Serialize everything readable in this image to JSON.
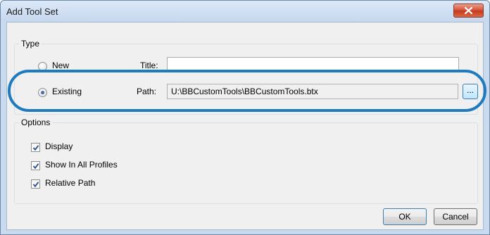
{
  "window": {
    "title": "Add Tool Set"
  },
  "type_group": {
    "legend": "Type",
    "new_label": "New",
    "existing_label": "Existing",
    "title_label": "Title:",
    "title_value": "",
    "path_label": "Path:",
    "path_value": "U:\\BBCustomTools\\BBCustomTools.btx",
    "browse_label": "...",
    "selected": "existing"
  },
  "options_group": {
    "legend": "Options",
    "items": [
      {
        "label": "Display",
        "checked": true
      },
      {
        "label": "Show In All Profiles",
        "checked": true
      },
      {
        "label": "Relative Path",
        "checked": true
      }
    ]
  },
  "buttons": {
    "ok": "OK",
    "cancel": "Cancel"
  },
  "colors": {
    "highlight": "#1e7bbf",
    "close_button": "#c63a1e"
  }
}
